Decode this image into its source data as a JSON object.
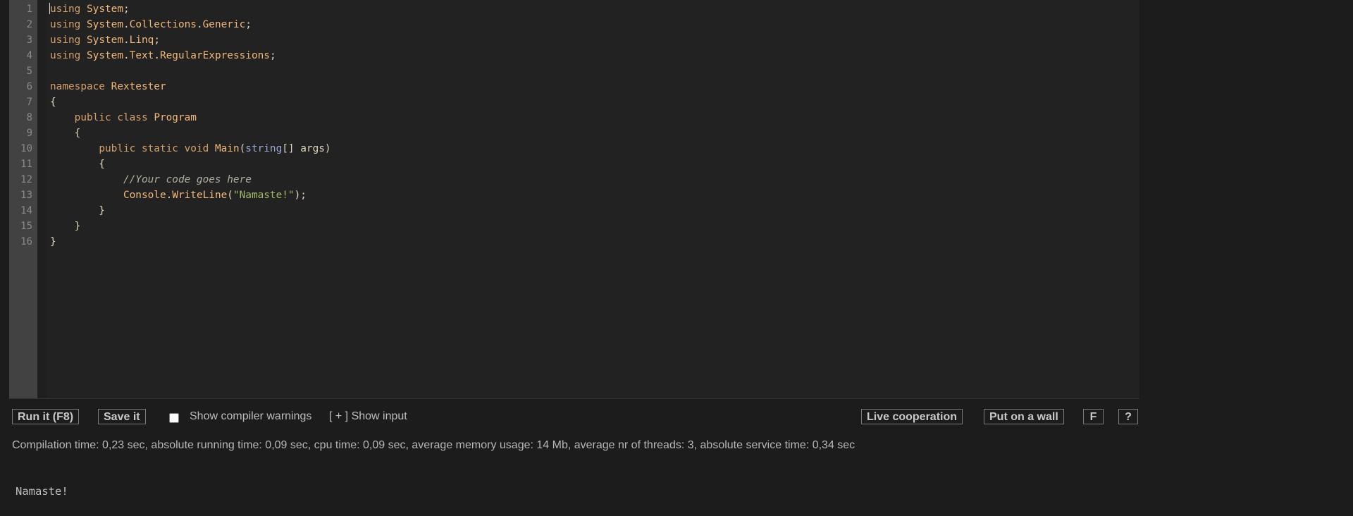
{
  "editor": {
    "line_numbers": [
      "1",
      "2",
      "3",
      "4",
      "5",
      "6",
      "7",
      "8",
      "9",
      "10",
      "11",
      "12",
      "13",
      "14",
      "15",
      "16"
    ],
    "lines": [
      "using System;",
      "using System.Collections.Generic;",
      "using System.Linq;",
      "using System.Text.RegularExpressions;",
      "",
      "namespace Rextester",
      "{",
      "    public class Program",
      "    {",
      "        public static void Main(string[] args)",
      "        {",
      "            //Your code goes here",
      "            Console.WriteLine(\"Namaste!\");",
      "        }",
      "    }",
      "}"
    ]
  },
  "toolbar": {
    "run_label": "Run it (F8)",
    "save_label": "Save it",
    "warnings_label": "Show compiler warnings",
    "warnings_checked": false,
    "show_input_label": "[ + ] Show input",
    "live_cooperation_label": "Live cooperation",
    "put_on_wall_label": "Put on a wall",
    "f_label": "F",
    "help_label": "?"
  },
  "stats": "Compilation time: 0,23 sec, absolute running time: 0,09 sec, cpu time: 0,09 sec, average memory usage: 14 Mb, average nr of threads: 3, absolute service time: 0,34 sec",
  "output": "Namaste!",
  "colors": {
    "background": "#1c1c1c",
    "editor_bg": "#222222",
    "gutter_bg": "#424242",
    "keyword": "#d6a06a",
    "type": "#f3b87a",
    "string_literal": "#a3b86a",
    "builtin_type": "#9aa7d4",
    "comment": "#b0ada0"
  }
}
